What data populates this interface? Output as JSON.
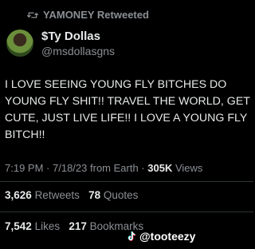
{
  "retweet": {
    "label": "YAMONEY Retweeted"
  },
  "author": {
    "display_name": "$Ty Dollas",
    "handle": "@msdollasgns"
  },
  "tweet": {
    "text": "I LOVE SEEING YOUNG FLY BITCHES DO YOUNG FLY SHIT!! TRAVEL THE WORLD, GET CUTE, JUST LIVE LIFE!! I LOVE A YOUNG FLY BITCH!!"
  },
  "meta": {
    "time": "7:19 PM",
    "date": "7/18/23",
    "source": "from Earth",
    "views_count": "305K",
    "views_label": "Views"
  },
  "stats": {
    "retweets_count": "3,626",
    "retweets_label": "Retweets",
    "quotes_count": "78",
    "quotes_label": "Quotes",
    "likes_count": "7,542",
    "likes_label": "Likes",
    "bookmarks_count": "217",
    "bookmarks_label": "Bookmarks"
  },
  "watermark": {
    "text": "@tooteezy"
  },
  "colors": {
    "background": "#000000",
    "text": "#e7e9ea",
    "muted": "#8b8f94",
    "divider": "#2f3336"
  },
  "icons": {
    "retweet": "retweet-icon",
    "tiktok": "tiktok-icon"
  }
}
